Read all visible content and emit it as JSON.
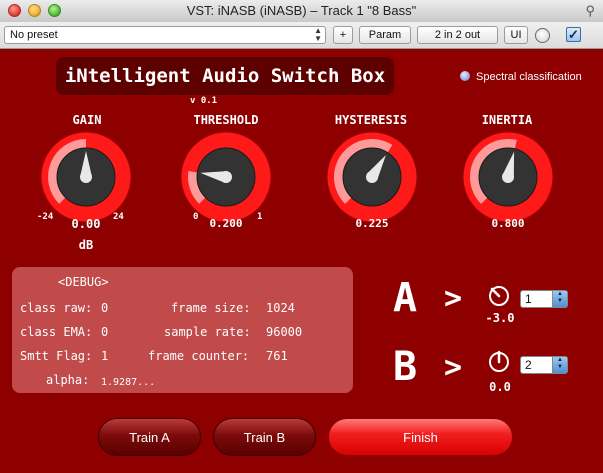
{
  "window": {
    "title": "VST: iNASB (iNASB) – Track 1 \"8 Bass\""
  },
  "toolbar": {
    "preset_value": "No preset",
    "add_label": "+",
    "param_label": "Param",
    "io_label": "2 in 2 out",
    "ui_label": "UI",
    "checkbox_mark": "✓"
  },
  "plugin": {
    "title": "iNtelligent Audio Switch Box",
    "version": "v 0.1",
    "spectral_label": "Spectral classification",
    "knobs": [
      {
        "label": "GAIN",
        "value": "0.00",
        "unit": "dB",
        "min": "-24",
        "max": "24",
        "level": 0.5
      },
      {
        "label": "THRESHOLD",
        "value": "0.200",
        "unit": "",
        "min": "0",
        "max": "1",
        "level": 0.2
      },
      {
        "label": "HYSTERESIS",
        "value": "0.225",
        "unit": "",
        "min": "",
        "max": "",
        "level": 0.62
      },
      {
        "label": "INERTIA",
        "value": "0.800",
        "unit": "",
        "min": "",
        "max": "",
        "level": 0.55
      }
    ],
    "debug": {
      "header": "<DEBUG>",
      "class_raw_label": "class raw:",
      "class_raw_value": "0",
      "class_ema_label": "class EMA:",
      "class_ema_value": "0",
      "smtt_label": "Smtt Flag:",
      "smtt_value": "1",
      "alpha_label": "alpha:",
      "alpha_value": "1.9287...",
      "frame_size_label": "frame size:",
      "frame_size_value": "1024",
      "sample_rate_label": "sample rate:",
      "sample_rate_value": "96000",
      "frame_counter_label": "frame counter:",
      "frame_counter_value": "761"
    },
    "routes": [
      {
        "letter": "A",
        "arrow": ">",
        "knob_value": "-3.0",
        "output": "1"
      },
      {
        "letter": "B",
        "arrow": ">",
        "knob_value": "0.0",
        "output": "2"
      }
    ],
    "buttons": {
      "train_a": "Train A",
      "train_b": "Train B",
      "finish": "Finish"
    }
  },
  "colors": {
    "panel": "#8e0000",
    "knob_ring": "#ff1a1a",
    "knob_fill": "#ff9a9a",
    "debug_bg": "#c14a4a"
  }
}
